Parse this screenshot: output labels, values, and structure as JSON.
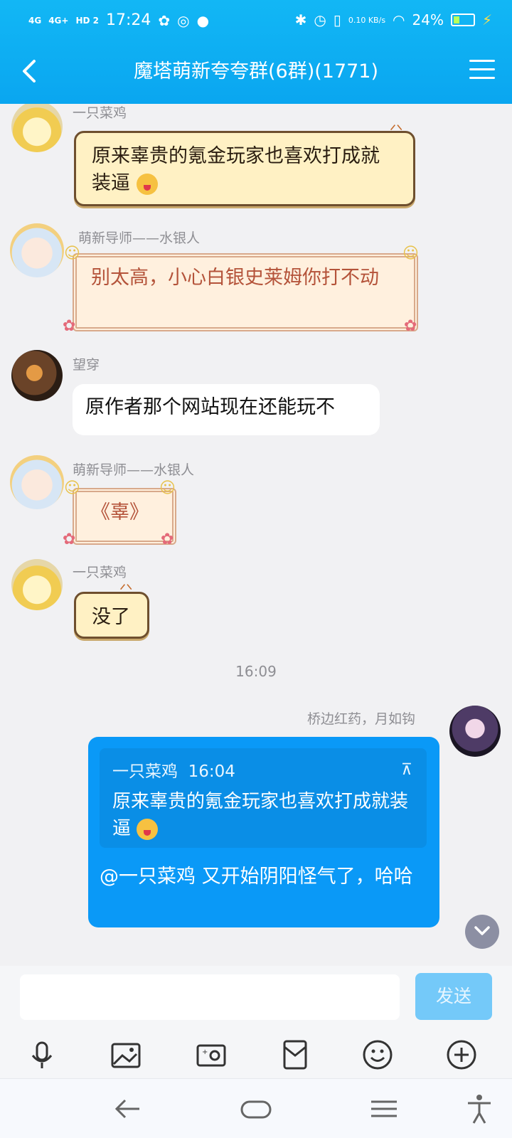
{
  "status_bar": {
    "time": "17:24",
    "network_left": [
      "4G",
      "4G+",
      "HD 2"
    ],
    "speed": "0.10 KB/s",
    "battery": "24%",
    "icons": [
      "paw-icon",
      "q-icon",
      "chat-bubble-icon",
      "bluetooth-icon",
      "alarm-icon",
      "vibrate-icon",
      "wifi-icon",
      "battery-icon",
      "charging-icon"
    ]
  },
  "header": {
    "title": "魔塔萌新夸夸群(6群)(1771)",
    "back_icon": "chevron-left-icon",
    "menu_icon": "hamburger-menu-icon"
  },
  "messages": [
    {
      "sender": "一只菜鸡",
      "text": "原来辜贵的氪金玩家也喜欢打成就装逼",
      "emoji": "tongue-out-emoji",
      "style": "yellow-cat"
    },
    {
      "sender": "萌新导师——水银人",
      "text": "别太高，小心白银史莱姆你打不动",
      "style": "angel-frame"
    },
    {
      "sender": "望穿",
      "text": "原作者那个网站现在还能玩不",
      "style": "white"
    },
    {
      "sender": "萌新导师——水银人",
      "text": "《辜》",
      "style": "angel-frame"
    },
    {
      "sender": "一只菜鸡",
      "text": "没了",
      "style": "yellow-cat"
    }
  ],
  "timestamp": "16:09",
  "my_message": {
    "sender": "桥边红药，月如钩",
    "quote_sender": "一只菜鸡",
    "quote_time": "16:04",
    "quote_text": "原来辜贵的氪金玩家也喜欢打成就装逼",
    "pin_icon": "pin-top-icon",
    "reply_text": "@一只菜鸡  又开始阴阳怪气了，哈哈"
  },
  "input": {
    "send_label": "发送",
    "value": ""
  },
  "toolbar": [
    "microphone-icon",
    "image-icon",
    "camera-icon",
    "red-packet-icon",
    "emoji-icon",
    "plus-icon"
  ],
  "nav": [
    "back-arrow-icon",
    "home-pill-icon",
    "recent-menu-icon",
    "accessibility-icon"
  ]
}
